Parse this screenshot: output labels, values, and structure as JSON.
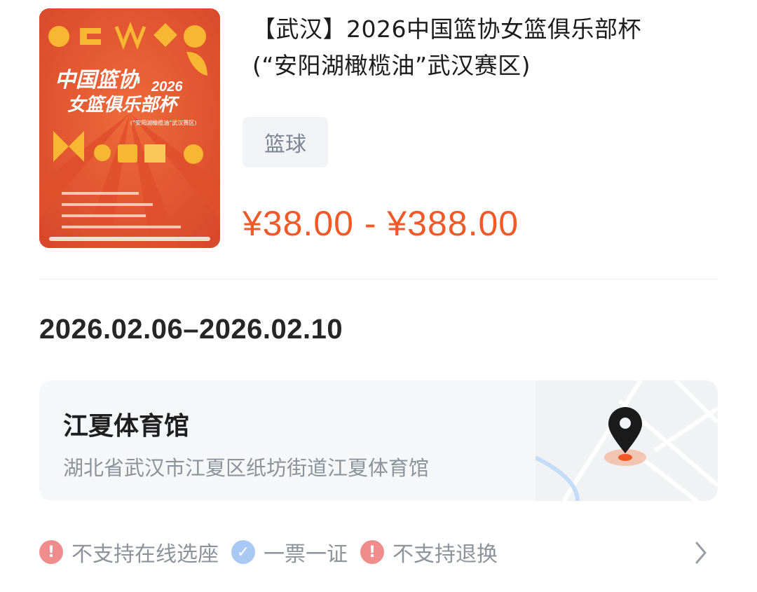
{
  "event": {
    "title_line1": "【武汉】2026中国篮协女篮俱乐部杯",
    "title_line2": "(“安阳湖橄榄油”武汉赛区)",
    "category_tag": "篮球",
    "price_range": "¥38.00 - ¥388.00",
    "date_range": "2026.02.06–2026.02.10"
  },
  "poster": {
    "headline_1": "中国篮协",
    "headline_2": "女篮俱乐部杯",
    "year": "2026",
    "subtitle": "(“安阳湖橄榄油”武汉赛区)",
    "brand_color": "#e4572e",
    "accent_color": "#f7b733"
  },
  "venue": {
    "name": "江夏体育馆",
    "address": "湖北省武汉市江夏区纸坊街道江夏体育馆",
    "icon": "map-pin-icon"
  },
  "policies": [
    {
      "icon": "warning-icon",
      "type": "warn",
      "label": "不支持在线选座"
    },
    {
      "icon": "check-icon",
      "type": "ok",
      "label": "一票一证"
    },
    {
      "icon": "warning-icon",
      "type": "warn",
      "label": "不支持退换"
    }
  ],
  "colors": {
    "price": "#f05a28",
    "warn": "#ef8d8d",
    "ok": "#a9c8f3"
  }
}
